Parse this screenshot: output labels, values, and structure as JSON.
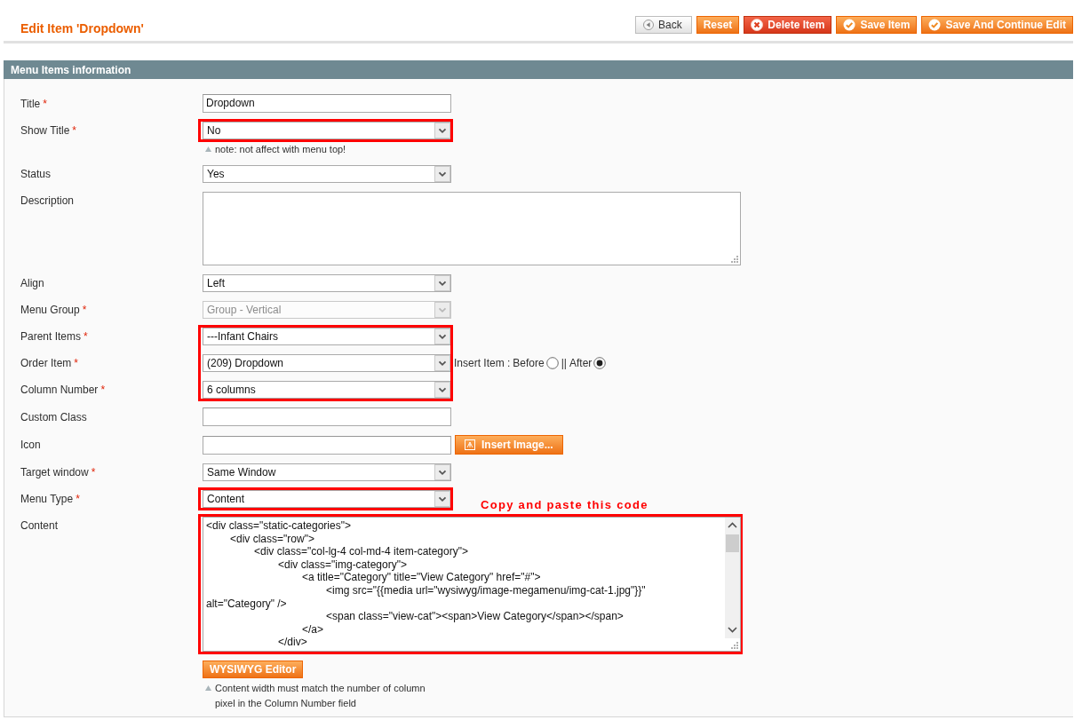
{
  "header": {
    "title": "Edit Item 'Dropdown'",
    "buttons": [
      {
        "label": "Back",
        "kind": "back"
      },
      {
        "label": "Reset",
        "kind": "reset"
      },
      {
        "label": "Delete Item",
        "kind": "delete"
      },
      {
        "label": "Save Item",
        "kind": "save"
      },
      {
        "label": "Save And Continue Edit",
        "kind": "save"
      }
    ]
  },
  "section": {
    "title": "Menu Items information"
  },
  "groups": [
    {
      "highlighted": false,
      "fields": [
        {
          "kind": "text",
          "label": "Title",
          "mark": "*",
          "value": "Dropdown"
        }
      ]
    },
    {
      "highlighted": true,
      "fields": [
        {
          "kind": "select",
          "label": "Show Title",
          "mark": "*",
          "value": "No",
          "disabled": false,
          "note": "note: not affect with menu top!"
        }
      ]
    },
    {
      "highlighted": false,
      "fields": [
        {
          "kind": "select",
          "label": "Status",
          "value": "Yes",
          "disabled": false
        },
        {
          "kind": "textarea",
          "label": "Description"
        },
        {
          "kind": "select",
          "label": "Align",
          "value": "Left",
          "disabled": false
        },
        {
          "kind": "select",
          "label": "Menu Group",
          "mark": "*",
          "value": "Group - Vertical",
          "disabled": true
        }
      ]
    },
    {
      "highlighted": true,
      "fields": [
        {
          "kind": "select",
          "label": "Parent Items",
          "mark": "*",
          "value": "---Infant Chairs",
          "disabled": false
        },
        {
          "kind": "select",
          "label": "Order Item",
          "mark": "*",
          "value": "(209) Dropdown",
          "disabled": false,
          "insert": {
            "label": "Insert Item :",
            "separator": "||",
            "options": [
              {
                "label": "Before",
                "selected": false
              },
              {
                "label": "After",
                "selected": true
              }
            ]
          }
        },
        {
          "kind": "select",
          "label": "Column Number",
          "mark": "*",
          "value": "6 columns",
          "disabled": false
        }
      ]
    },
    {
      "highlighted": false,
      "fields": [
        {
          "kind": "text",
          "label": "Custom Class"
        },
        {
          "kind": "image",
          "label": "Icon",
          "button": "Insert Image..."
        },
        {
          "kind": "select",
          "label": "Target window",
          "mark": "*",
          "value": "Same Window",
          "disabled": false
        }
      ]
    },
    {
      "highlighted": true,
      "fields": [
        {
          "kind": "select",
          "label": "Menu Type",
          "mark": "*",
          "value": "Content",
          "disabled": false
        }
      ]
    },
    {
      "highlighted": true,
      "callout": "Copy and paste this code",
      "fields": [
        {
          "kind": "code",
          "label": "Content",
          "lines": [
            "<div class=\"static-categories\">",
            "\t<div class=\"row\">",
            "\t\t<div class=\"col-lg-4 col-md-4 item-category\">",
            "\t\t\t<div class=\"img-category\">",
            "\t\t\t\t<a title=\"Category\" title=\"View Category\" href=\"#\">",
            "\t\t\t\t\t<img src=\"{{media url=\"wysiwyg/image-megamenu/img-cat-1.jpg\"}}\"",
            "alt=\"Category\" />",
            "\t\t\t\t\t<span class=\"view-cat\"><span>View Category</span></span>",
            "\t\t\t\t</a>",
            "\t\t\t</div>"
          ],
          "button": "WYSIWYG Editor",
          "note": "Content width must match the number of column pixel in the Column Number field"
        }
      ]
    }
  ]
}
